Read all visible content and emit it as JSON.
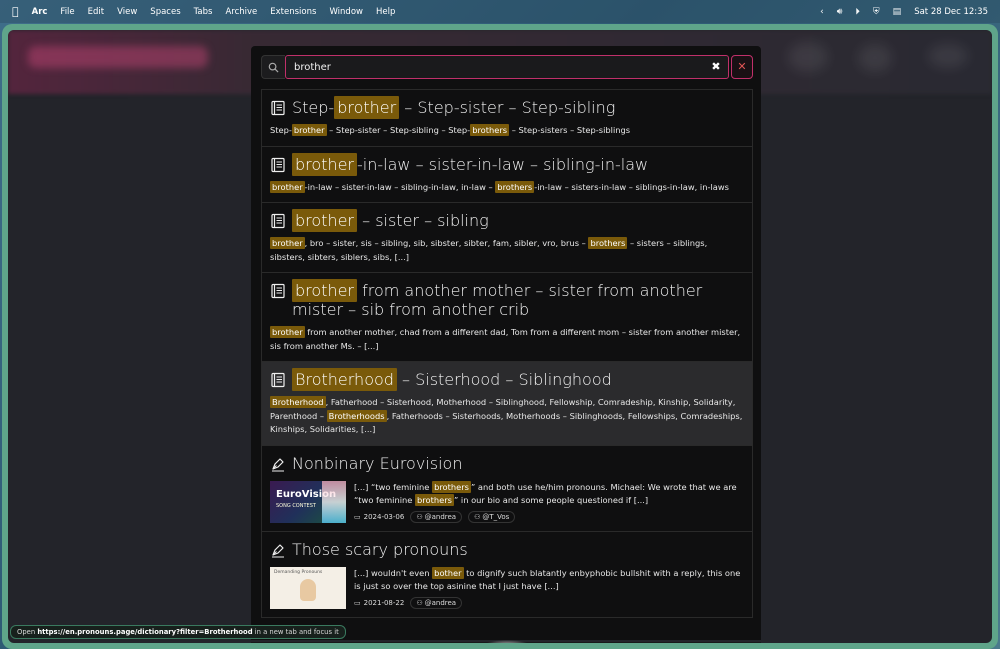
{
  "menubar": {
    "app": "Arc",
    "items": [
      "File",
      "Edit",
      "View",
      "Spaces",
      "Tabs",
      "Archive",
      "Extensions",
      "Window",
      "Help"
    ],
    "datetime": "Sat 28 Dec  12:35"
  },
  "search": {
    "value": "brother",
    "placeholder": ""
  },
  "results": [
    {
      "icon": "dictionary-icon",
      "title": [
        {
          "t": "Step-"
        },
        {
          "t": "brother",
          "h": true
        },
        {
          "t": " – Step-sister – Step-sibling"
        }
      ],
      "desc": [
        {
          "t": "Step-"
        },
        {
          "t": "brother",
          "h": true
        },
        {
          "t": " – Step-sister – Step-sibling – Step-"
        },
        {
          "t": "brothers",
          "h": true
        },
        {
          "t": " – Step-sisters – Step-siblings"
        }
      ]
    },
    {
      "icon": "dictionary-icon",
      "title": [
        {
          "t": "brother",
          "h": true
        },
        {
          "t": "-in-law – sister-in-law – sibling-in-law"
        }
      ],
      "desc": [
        {
          "t": "brother",
          "h": true
        },
        {
          "t": "-in-law – sister-in-law – sibling-in-law, in-law – "
        },
        {
          "t": "brothers",
          "h": true
        },
        {
          "t": "-in-law – sisters-in-law – siblings-in-law, in-laws"
        }
      ]
    },
    {
      "icon": "dictionary-icon",
      "title": [
        {
          "t": "brother",
          "h": true
        },
        {
          "t": " – sister – sibling"
        }
      ],
      "desc": [
        {
          "t": "brother",
          "h": true
        },
        {
          "t": ", bro – sister, sis – sibling, sib, sibster, sibter, fam, sibler, vro, brus – "
        },
        {
          "t": "brothers",
          "h": true
        },
        {
          "t": " – sisters – siblings, sibsters, sibters, siblers, sibs, [...]"
        }
      ]
    },
    {
      "icon": "dictionary-icon",
      "title": [
        {
          "t": "brother",
          "h": true
        },
        {
          "t": " from another mother – sister from another mister – sib from another crib"
        }
      ],
      "desc": [
        {
          "t": "brother",
          "h": true
        },
        {
          "t": " from another mother, chad from a different dad, Tom from a different mom – sister from another mister, sis from another Ms. – [...]"
        }
      ]
    },
    {
      "icon": "dictionary-icon",
      "active": true,
      "title": [
        {
          "t": "Brotherhood",
          "h": true
        },
        {
          "t": " – Sisterhood – Siblinghood"
        }
      ],
      "desc": [
        {
          "t": "Brotherhood",
          "h": true
        },
        {
          "t": ", Fatherhood – Sisterhood, Motherhood – Siblinghood, Fellowship, Comradeship, Kinship, Solidarity, Parenthood – "
        },
        {
          "t": "Brotherhoods",
          "h": true
        },
        {
          "t": ", Fatherhoods – Sisterhoods, Motherhoods – Siblinghoods, Fellowships, Comradeships, Kinships, Solidarities, [...]"
        }
      ]
    }
  ],
  "blog_results": [
    {
      "icon": "pen-icon",
      "title": "Nonbinary Eurovision",
      "thumb": "euro",
      "thumb_text": [
        "EuroVision",
        "SONG CONTEST"
      ],
      "text": [
        {
          "t": "[...] “two feminine "
        },
        {
          "t": "brothers",
          "h": true
        },
        {
          "t": "” and both use he/him pronouns. Michael: We wrote that we are “two feminine "
        },
        {
          "t": "brothers",
          "h": true
        },
        {
          "t": "” in our bio and some people questioned if [...]"
        }
      ],
      "date": "2024-03-06",
      "authors": [
        "@andrea",
        "@T_Vos"
      ]
    },
    {
      "icon": "pen-icon",
      "title": "Those scary pronouns",
      "thumb": "pron",
      "thumb_text": [
        "Demanding Pronouns"
      ],
      "text": [
        {
          "t": "[...] wouldn't even "
        },
        {
          "t": "bother",
          "h": true
        },
        {
          "t": " to dignify such blatantly enbyphobic bullshit with a reply, this one is just so over the top asinine that I just have [...]"
        }
      ],
      "date": "2021-08-22",
      "authors": [
        "@andrea"
      ]
    }
  ],
  "status": {
    "prefix": "Open ",
    "url": "https://en.pronouns.page/dictionary?filter=Brotherhood",
    "suffix": " in a new tab and focus it"
  }
}
